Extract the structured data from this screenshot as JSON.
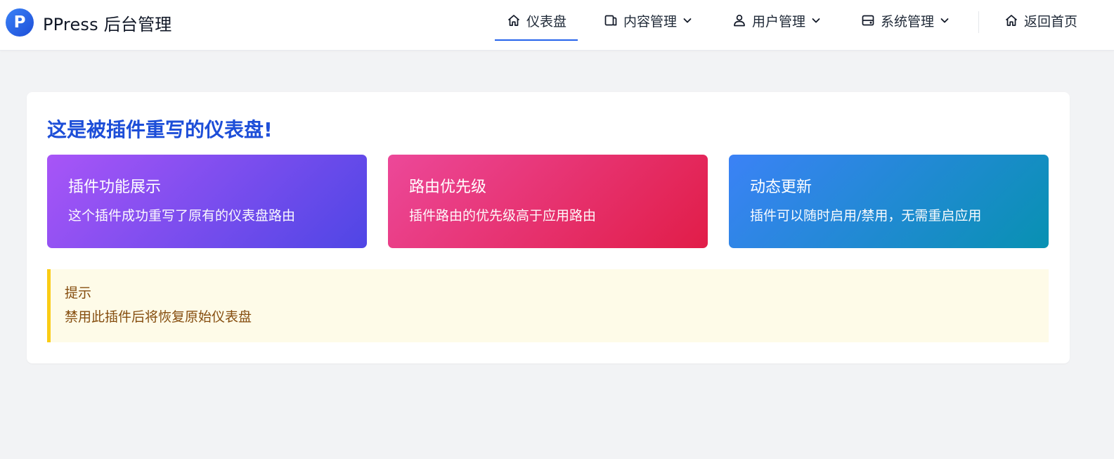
{
  "brand": {
    "logo_letter": "P",
    "title": "PPress 后台管理",
    "logo_color": "#2563eb"
  },
  "nav": {
    "items": [
      {
        "label": "仪表盘",
        "icon": "home-icon",
        "active": true,
        "has_dropdown": false
      },
      {
        "label": "内容管理",
        "icon": "document-icon",
        "active": false,
        "has_dropdown": true
      },
      {
        "label": "用户管理",
        "icon": "users-icon",
        "active": false,
        "has_dropdown": true
      },
      {
        "label": "系统管理",
        "icon": "server-icon",
        "active": false,
        "has_dropdown": true
      }
    ],
    "back_home": {
      "label": "返回首页",
      "icon": "home-icon"
    },
    "active_color": "#2563eb"
  },
  "panel": {
    "title": "这是被插件重写的仪表盘!",
    "cards": [
      {
        "title": "插件功能展示",
        "desc": "这个插件成功重写了原有的仪表盘路由",
        "gradient": [
          "#a855f7",
          "#4f46e5"
        ]
      },
      {
        "title": "路由优先级",
        "desc": "插件路由的优先级高于应用路由",
        "gradient": [
          "#ec4899",
          "#e11d48"
        ]
      },
      {
        "title": "动态更新",
        "desc": "插件可以随时启用/禁用，无需重启应用",
        "gradient": [
          "#3b82f6",
          "#0891b2"
        ]
      }
    ],
    "tip": {
      "title": "提示",
      "desc": "禁用此插件后将恢复原始仪表盘",
      "border_color": "#facc15",
      "background": "#fefbe8"
    }
  }
}
